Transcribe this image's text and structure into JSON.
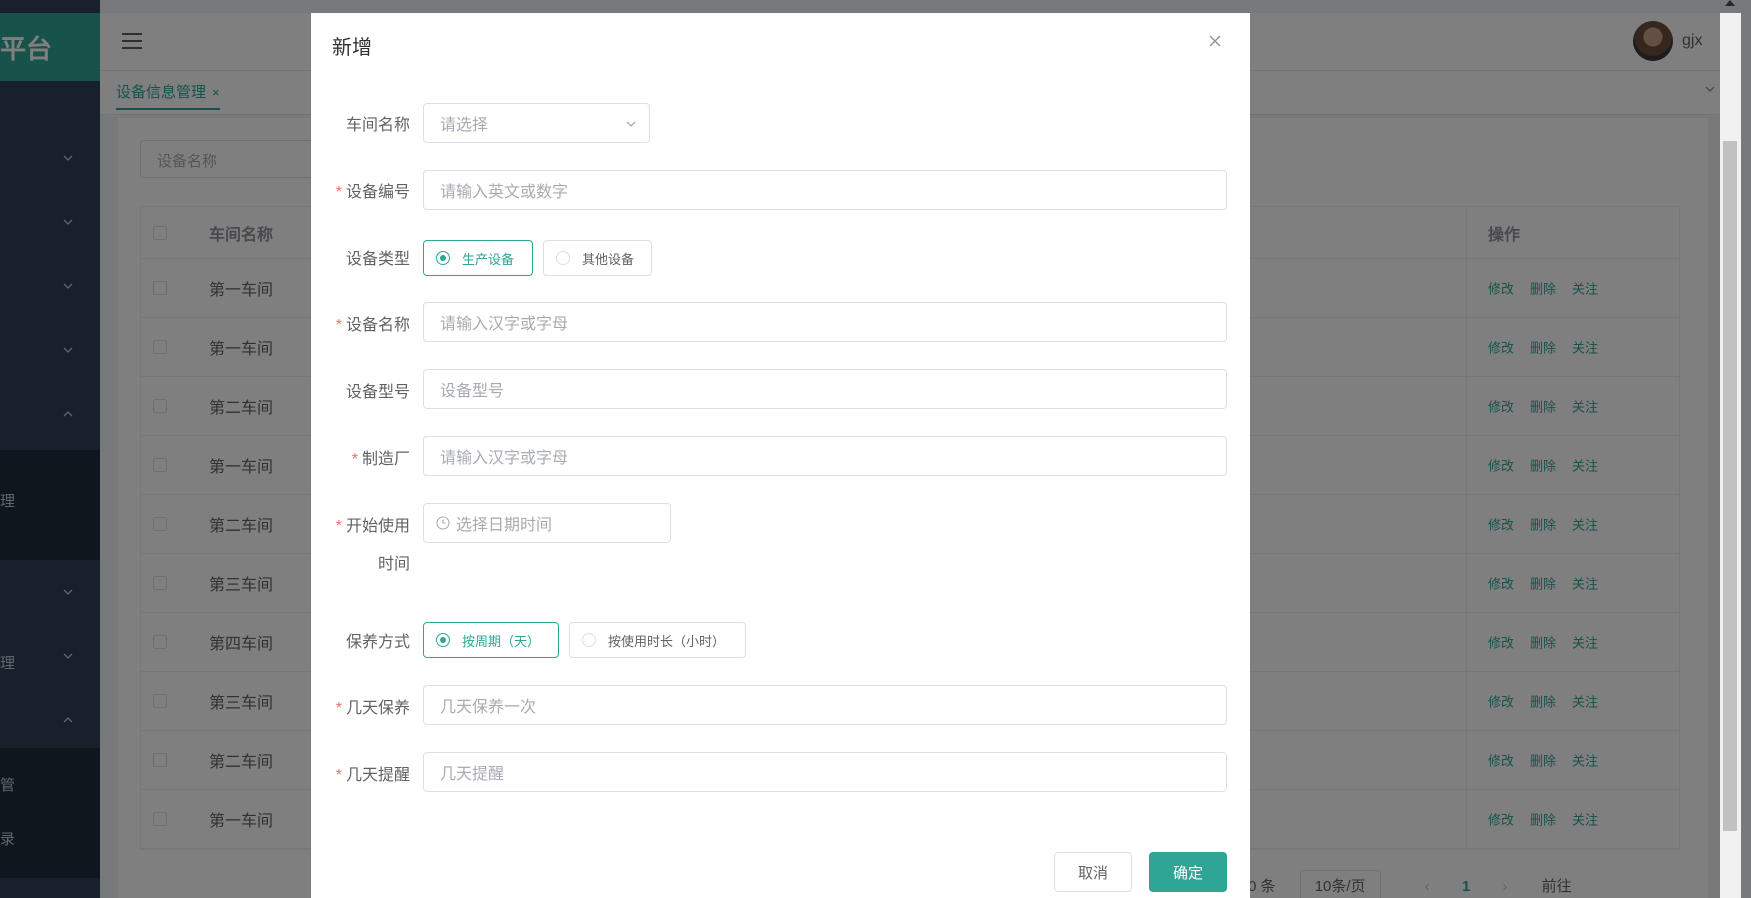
{
  "app": {
    "logo_text": "平台",
    "username": "gjx"
  },
  "sidebar": {
    "items": [
      {
        "label": ""
      },
      {
        "label": ""
      },
      {
        "label": ""
      },
      {
        "label": ""
      },
      {
        "label": ""
      },
      {
        "label": "理"
      },
      {
        "label": ""
      },
      {
        "label": "理"
      },
      {
        "label": ""
      },
      {
        "label": "管"
      },
      {
        "label": "录"
      }
    ]
  },
  "tabs": [
    {
      "label": "设备信息管理",
      "close": "×"
    }
  ],
  "search": {
    "placeholder": "设备名称"
  },
  "table": {
    "headers": [
      "车间名称",
      "操作"
    ],
    "rows": [
      {
        "workshop": "第一车间"
      },
      {
        "workshop": "第一车间"
      },
      {
        "workshop": "第二车间"
      },
      {
        "workshop": "第一车间"
      },
      {
        "workshop": "第二车间"
      },
      {
        "workshop": "第三车间"
      },
      {
        "workshop": "第四车间"
      },
      {
        "workshop": "第三车间"
      },
      {
        "workshop": "第二车间"
      },
      {
        "workshop": "第一车间"
      }
    ],
    "actions": [
      "修改",
      "删除",
      "关注"
    ]
  },
  "pagination": {
    "total_suffix": "0 条",
    "page_size": "10条/页",
    "current_page": "1",
    "goto_label": "前往"
  },
  "dialog": {
    "title": "新增",
    "fields": {
      "workshop": {
        "label": "车间名称",
        "placeholder": "请选择",
        "required": false
      },
      "device_no": {
        "label": "设备编号",
        "placeholder": "请输入英文或数字",
        "required": true
      },
      "device_type": {
        "label": "设备类型",
        "required": false,
        "options": [
          "生产设备",
          "其他设备"
        ],
        "selected": "生产设备"
      },
      "device_name": {
        "label": "设备名称",
        "placeholder": "请输入汉字或字母",
        "required": true
      },
      "device_model": {
        "label": "设备型号",
        "placeholder": "设备型号",
        "required": false
      },
      "manufacturer": {
        "label": "制造厂",
        "placeholder": "请输入汉字或字母",
        "required": true
      },
      "start_time": {
        "label_line1": "开始使用",
        "label_line2": "时间",
        "placeholder": "选择日期时间",
        "required": true
      },
      "maintain_mode": {
        "label": "保养方式",
        "required": false,
        "options": [
          "按周期（天）",
          "按使用时长（小时）"
        ],
        "selected": "按周期（天）"
      },
      "maintain_days": {
        "label": "几天保养",
        "placeholder": "几天保养一次",
        "required": true
      },
      "remind_days": {
        "label": "几天提醒",
        "placeholder": "几天提醒",
        "required": true
      }
    },
    "required_mark": "*",
    "buttons": {
      "cancel": "取消",
      "confirm": "确定"
    }
  },
  "colors": {
    "primary": "#2fa596",
    "sidebar_bg": "#304156",
    "required": "#f56c6c"
  }
}
